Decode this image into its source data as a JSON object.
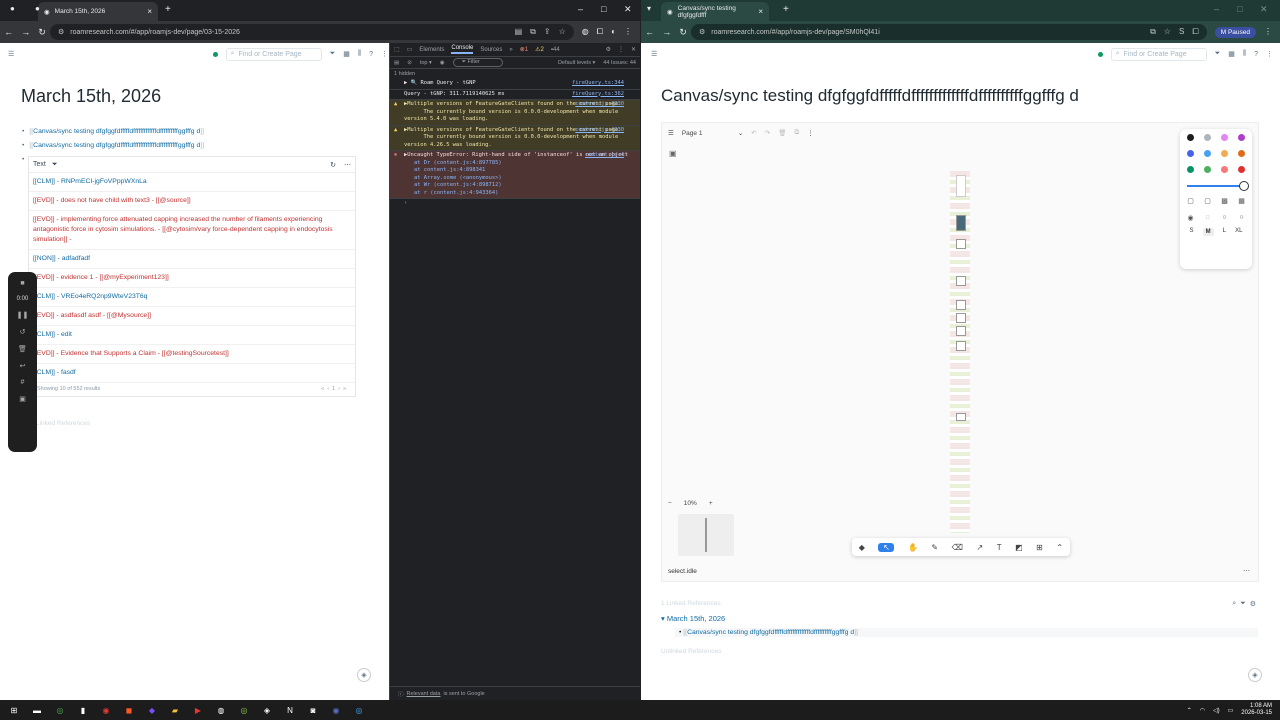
{
  "left": {
    "tab_title": "March 15th, 2026",
    "url": "roamresearch.com/#/app/roamjs-dev/page/03-15-2026",
    "search_placeholder": "Find or Create Page",
    "page_title": "March 15th, 2026",
    "bullets": [
      "Canvas/sync testing dfgfggfdfffffdfffffffffffffdffffffffffggfffg d",
      "Canvas/sync testing dfgfggfdfffffdfffffffffffffdffffffffffggfffg d"
    ],
    "query": {
      "column": "Text",
      "rows": [
        {
          "text": "[[CLM]] - RNPmECI-jgFoVPppWXnLa",
          "tone": "link"
        },
        {
          "text": "[[EVD]] - does not have child with text3 - [[@source]]",
          "tone": "red"
        },
        {
          "text": "[[EVD]] - implementing force attenuated capping increased the number of filaments experiencing antagonistic force in cytosim simulations. - [[@cytosim/vary force-dependent capping in endocytosis simulation]] -",
          "tone": "red"
        },
        {
          "text": "[[NON]] - adfadfadf",
          "tone": "link"
        },
        {
          "text": "[[EVD]] - evidence 1 - [[@myExperiment123]]",
          "tone": "red"
        },
        {
          "text": "[[CLM]] - VREo4eRQ2np9WteV23T6q",
          "tone": "link"
        },
        {
          "text": "[[EVD]] - asdfasdf asdf - [[@Mysource]]",
          "tone": "red"
        },
        {
          "text": "[[CLM]] - edit",
          "tone": "link"
        },
        {
          "text": "[[EVD]] - Evidence that Supports a Claim - [[@testingSourcetest]]",
          "tone": "red"
        },
        {
          "text": "[[CLM]] - fasdf",
          "tone": "link"
        }
      ],
      "footer": "Showing 10 of 552 results",
      "page": "1"
    },
    "linked_refs": "Linked References",
    "recorder_time": "0:00"
  },
  "devtools": {
    "tabs": [
      "Elements",
      "Console",
      "Sources"
    ],
    "error_count": "1",
    "warn_count": "2",
    "issue_count": "44",
    "context": "top",
    "filter_placeholder": "Filter",
    "levels": "Default levels",
    "issues_label": "44 Issues:",
    "issues_num": "44",
    "hidden": "1 hidden",
    "lines": [
      {
        "kind": "log",
        "text": "▶ 🔍 Roam Query - tGNP",
        "src": "fireQuery.ts:344"
      },
      {
        "kind": "log",
        "text": "Query - tGNP: 311.7119140625 ms",
        "src": "fireQuery.ts:362"
      },
      {
        "kind": "warn",
        "text": "▶Multiple versions of FeatureGateClients found on the current page.\n      The currently bound version is 0.0.0-development when module version 5.4.0 was loading.",
        "src": "content.js:4330"
      },
      {
        "kind": "warn",
        "text": "▶Multiple versions of FeatureGateClients found on the current page.\n      The currently bound version is 0.0.0-development when module version 4.26.5 was loading.",
        "src": "content.js:4330"
      },
      {
        "kind": "error",
        "text": "▶Uncaught TypeError: Right-hand side of 'instanceof' is not an object",
        "src": "content.js:4"
      }
    ],
    "stack": [
      "at Dr (content.js:4:897785)",
      "at content.js:4:898341",
      "at Array.some (<anonymous>)",
      "at Wr (content.js:4:898712)",
      "at r (content.js:4:943364)"
    ],
    "footer_link": "Relevant data",
    "footer_text": "is sent to Google"
  },
  "right": {
    "tab_title": "Canvas/sync testing dfgfggfdfff",
    "url": "roamresearch.com/#/app/roamjs-dev/page/SM0hQl41i",
    "paused": "Paused",
    "profile": "M",
    "search_placeholder": "Find or Create Page",
    "page_title": "Canvas/sync testing dfgfggfdfffffdfffffffffffffdffffffffffggfffg d",
    "canvas": {
      "page_label": "Page 1",
      "zoom": "10%",
      "status": "select.idle",
      "sizes": [
        "S",
        "M",
        "L",
        "XL"
      ],
      "colors": [
        "#1d1d1d",
        "#adb5bd",
        "#e085f4",
        "#ae3ec9",
        "#4465e9",
        "#4ba1f1",
        "#f1ac4b",
        "#e16919",
        "#099268",
        "#4cb05e",
        "#f87777",
        "#e03131"
      ]
    },
    "linked_refs": "1 Linked References",
    "ref_page": "March 15th, 2026",
    "ref_text": "Canvas/sync testing dfgfggfdfffffdfffffffffffffdffffffffffggfffg d",
    "unlinked_refs": "Unlinked References"
  },
  "taskbar": {
    "time": "1:08 AM",
    "date": "2026-03-15"
  }
}
